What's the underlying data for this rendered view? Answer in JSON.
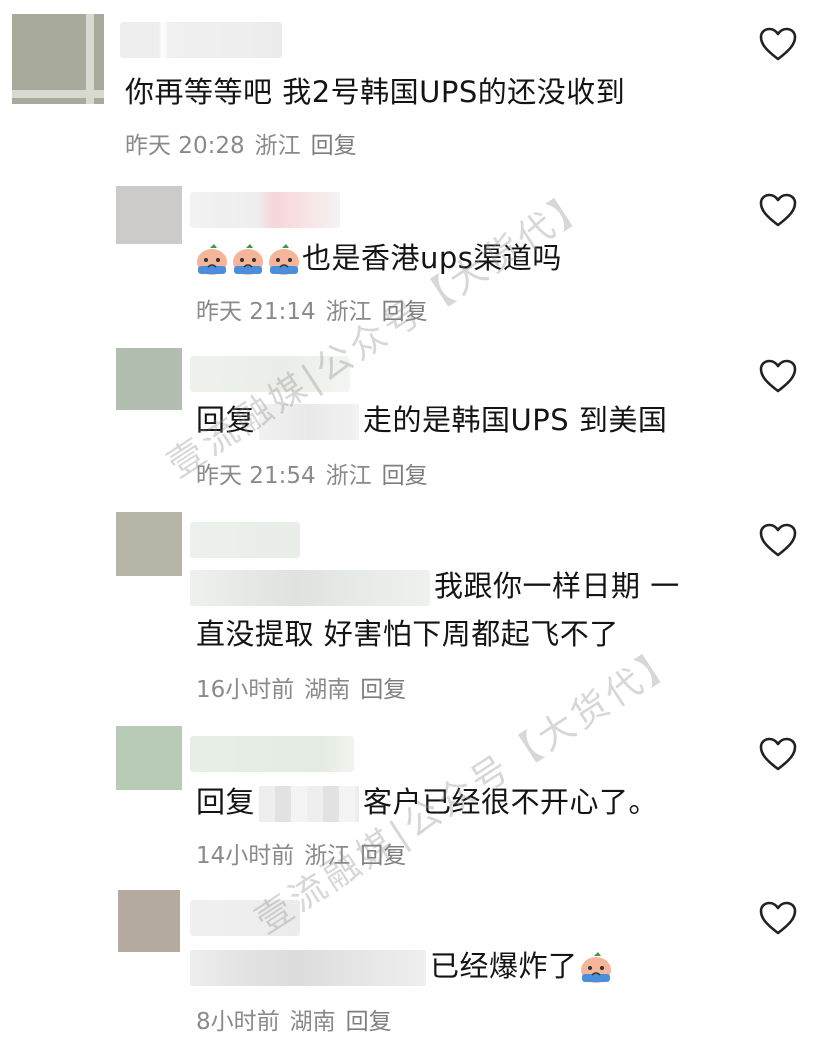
{
  "comments": [
    {
      "text": "你再等等吧 我2号韩国UPS的还没收到",
      "time": "昨天 20:28",
      "location": "浙江",
      "reply": "回复"
    },
    {
      "text": "也是香港ups渠道吗",
      "time": "昨天 21:14",
      "location": "浙江",
      "reply": "回复"
    },
    {
      "reply_prefix": "回复",
      "text": "走的是韩国UPS  到美国",
      "time": "昨天 21:54",
      "location": "浙江",
      "reply": "回复"
    },
    {
      "text_line1": "我跟你一样日期 一",
      "text_line2": "直没提取 好害怕下周都起飞不了",
      "time": "16小时前",
      "location": "湖南",
      "reply": "回复"
    },
    {
      "reply_prefix": "回复",
      "text": "客户已经很不开心了。",
      "time": "14小时前",
      "location": "浙江",
      "reply": "回复"
    },
    {
      "text": "已经爆炸了",
      "time": "8小时前",
      "location": "湖南",
      "reply": "回复"
    }
  ],
  "watermark": {
    "text1": "壹流融媒|公众号【大货代】",
    "text2": "壹流融媒|公众号【大货代】"
  },
  "colors": {
    "text": "#141414",
    "meta": "#8a8a8a",
    "watermark": "#8c8c8c"
  },
  "icons": {
    "like": "heart-outline-icon",
    "emoji": "crying-face-emoji-icon"
  }
}
